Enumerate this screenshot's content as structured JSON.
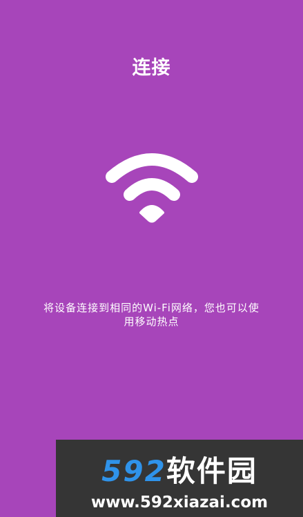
{
  "screen": {
    "background_color": "#a745ba",
    "title": "连接",
    "icon": "wifi-icon",
    "description_lines": [
      "将设备连接到相同的Wi-Fi网络，您也可以使",
      "用移动热点"
    ]
  },
  "watermark": {
    "digits": "592",
    "name": "软件园",
    "url": "www.592xiazai.com",
    "digits_color": "#2f93ea"
  }
}
